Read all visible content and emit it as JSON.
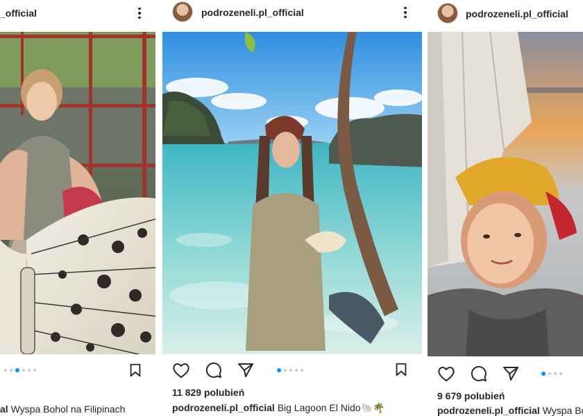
{
  "posts": [
    {
      "username": "_official",
      "caption_user": "al",
      "caption_text": "Wyspa Bohol na Filipinach",
      "carousel_active": 2,
      "carousel_count": 5
    },
    {
      "username": "podrozeneli.pl_official",
      "likes": "11 829 polubień",
      "caption_user": "podrozeneli.pl_official",
      "caption_text": "Big Lagoon El Nido🐚🌴",
      "carousel_active": 0,
      "carousel_count": 5
    },
    {
      "username": "podrozeneli.pl_official",
      "likes": "9 679 polubień",
      "caption_user": "podrozeneli.pl_official",
      "caption_text": "Wyspa Bo",
      "carousel_active": 0,
      "carousel_count": 4
    }
  ],
  "icons": {
    "like": "heart-icon",
    "comment": "comment-icon",
    "share": "send-icon",
    "save": "bookmark-icon",
    "more": "more-options-icon"
  },
  "colors": {
    "accent": "#0095f6",
    "text": "#262626"
  }
}
